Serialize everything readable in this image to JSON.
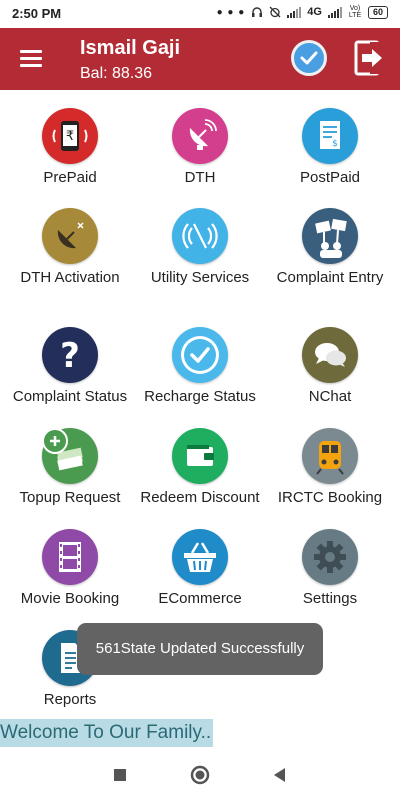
{
  "status_bar": {
    "time": "2:50 PM",
    "network": "4G",
    "lte_label": "Vo) LTE",
    "battery": "60"
  },
  "header": {
    "user_name": "Ismail Gaji",
    "balance": "Bal: 88.36",
    "accent_color": "#b32c35"
  },
  "tiles": [
    {
      "label": "PrePaid",
      "icon": "mobile-rupee-icon",
      "color": "#d42a2a"
    },
    {
      "label": "DTH",
      "icon": "satellite-dish-icon",
      "color": "#d43f8d"
    },
    {
      "label": "PostPaid",
      "icon": "bill-icon",
      "color": "#2a9ed9"
    },
    {
      "label": "DTH Activation",
      "icon": "satellite-dish-icon",
      "color": "#a68a3a"
    },
    {
      "label": "Utility Services",
      "icon": "wireless-signal-icon",
      "color": "#42b3e6"
    },
    {
      "label": "Complaint Entry",
      "icon": "protest-sign-icon",
      "color": "#3a5f7e"
    },
    {
      "label": "Complaint Status",
      "icon": "question-mark-icon",
      "color": "#232e5a"
    },
    {
      "label": "Recharge Status",
      "icon": "checkmark-icon",
      "color": "#4ab8ea"
    },
    {
      "label": "NChat",
      "icon": "chat-bubbles-icon",
      "color": "#6e6a3c"
    },
    {
      "label": "Topup Request",
      "icon": "money-stack-icon",
      "color": "#4a9b4f"
    },
    {
      "label": "Redeem Discount",
      "icon": "wallet-icon",
      "color": "#1fae5f"
    },
    {
      "label": "IRCTC Booking",
      "icon": "train-icon",
      "color": "#7b8a90"
    },
    {
      "label": "Movie Booking",
      "icon": "film-strip-icon",
      "color": "#8e4aa6"
    },
    {
      "label": "ECommerce",
      "icon": "shopping-basket-icon",
      "color": "#1f8bc9"
    },
    {
      "label": "Settings",
      "icon": "gear-icon",
      "color": "#677b84"
    },
    {
      "label": "Reports",
      "icon": "report-document-icon",
      "color": "#1f6b8f"
    }
  ],
  "toast": {
    "message": "561State Updated Successfully"
  },
  "footer": {
    "welcome": "Welcome To Our Family.."
  }
}
